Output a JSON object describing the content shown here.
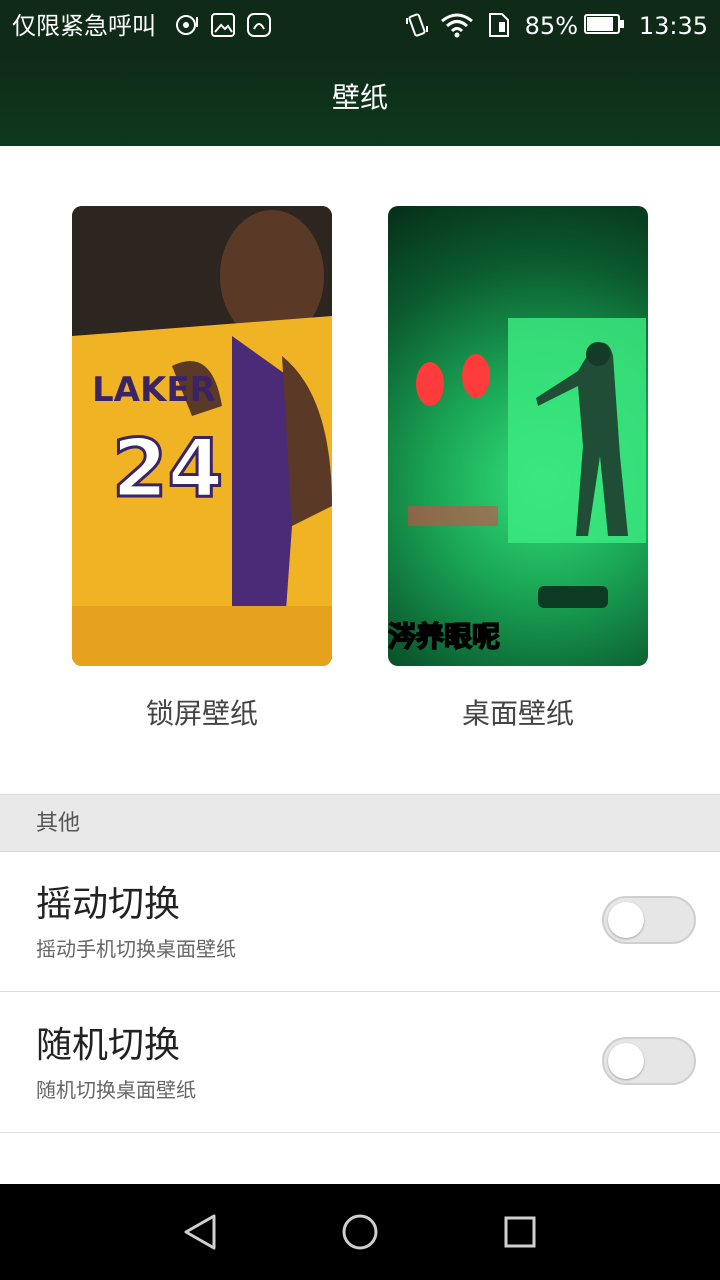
{
  "status_bar": {
    "carrier": "仅限紧急呼叫",
    "battery_percent_text": "85%",
    "battery_level": 0.85,
    "time": "13:35",
    "icons": [
      "hotspot-icon",
      "image-icon",
      "huawei-icon",
      "vibrate-icon",
      "wifi-icon",
      "sim-icon",
      "battery-icon"
    ]
  },
  "app_bar": {
    "title": "壁纸"
  },
  "previews": [
    {
      "label": "锁屏壁纸",
      "overlay_text": ""
    },
    {
      "label": "桌面壁纸",
      "overlay_text": "涔养眼呢"
    }
  ],
  "section": {
    "title": "其他"
  },
  "settings": [
    {
      "title": "摇动切换",
      "subtitle": "摇动手机切换桌面壁纸",
      "enabled": false
    },
    {
      "title": "随机切换",
      "subtitle": "随机切换桌面壁纸",
      "enabled": false
    }
  ],
  "nav_bar": {
    "buttons": [
      "back-icon",
      "home-icon",
      "recents-icon"
    ]
  },
  "colors": {
    "app_bar": "#0f2a17",
    "toggle_off": "#e6e6e6",
    "nav_bar": "#000000"
  }
}
